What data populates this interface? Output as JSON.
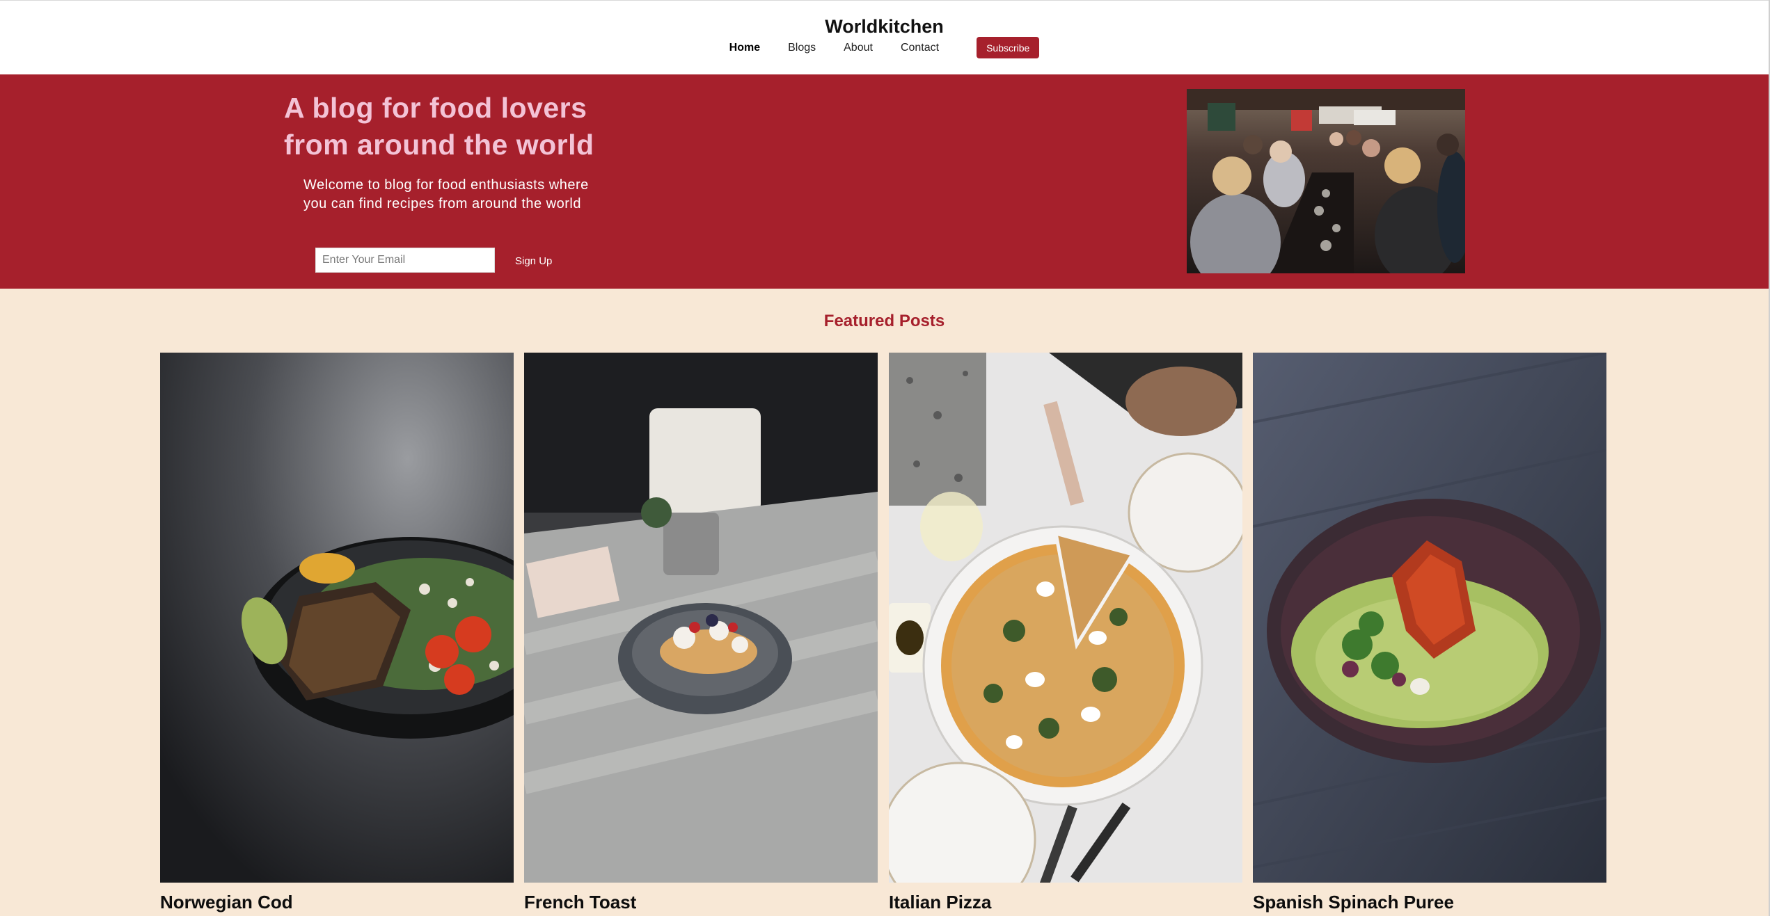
{
  "header": {
    "brand": "Worldkitchen",
    "nav": [
      {
        "label": "Home",
        "active": true
      },
      {
        "label": "Blogs",
        "active": false
      },
      {
        "label": "About",
        "active": false
      },
      {
        "label": "Contact",
        "active": false
      }
    ],
    "subscribe_label": "Subscribe"
  },
  "hero": {
    "title_line1": "A blog for food lovers",
    "title_line2": "from around the world",
    "subtitle": "Welcome to blog for food enthusiasts where you can find recipes from around the world",
    "email_placeholder": "Enter Your Email",
    "signup_label": "Sign Up",
    "image": "restaurant-diners-photo"
  },
  "featured": {
    "title": "Featured Posts",
    "posts": [
      {
        "name": "Norwegian Cod",
        "image": "grilled-cod-salad-bowl-photo"
      },
      {
        "name": "French Toast",
        "image": "french-toast-plate-photo"
      },
      {
        "name": "Italian Pizza",
        "image": "pizza-overhead-photo"
      },
      {
        "name": "Spanish Spinach Puree",
        "image": "spinach-puree-bowl-photo"
      }
    ]
  },
  "colors": {
    "accent": "#a6202c",
    "hero_title": "#f3c3d6",
    "page_background": "#f8e8d6",
    "header_background": "#ffffff"
  }
}
